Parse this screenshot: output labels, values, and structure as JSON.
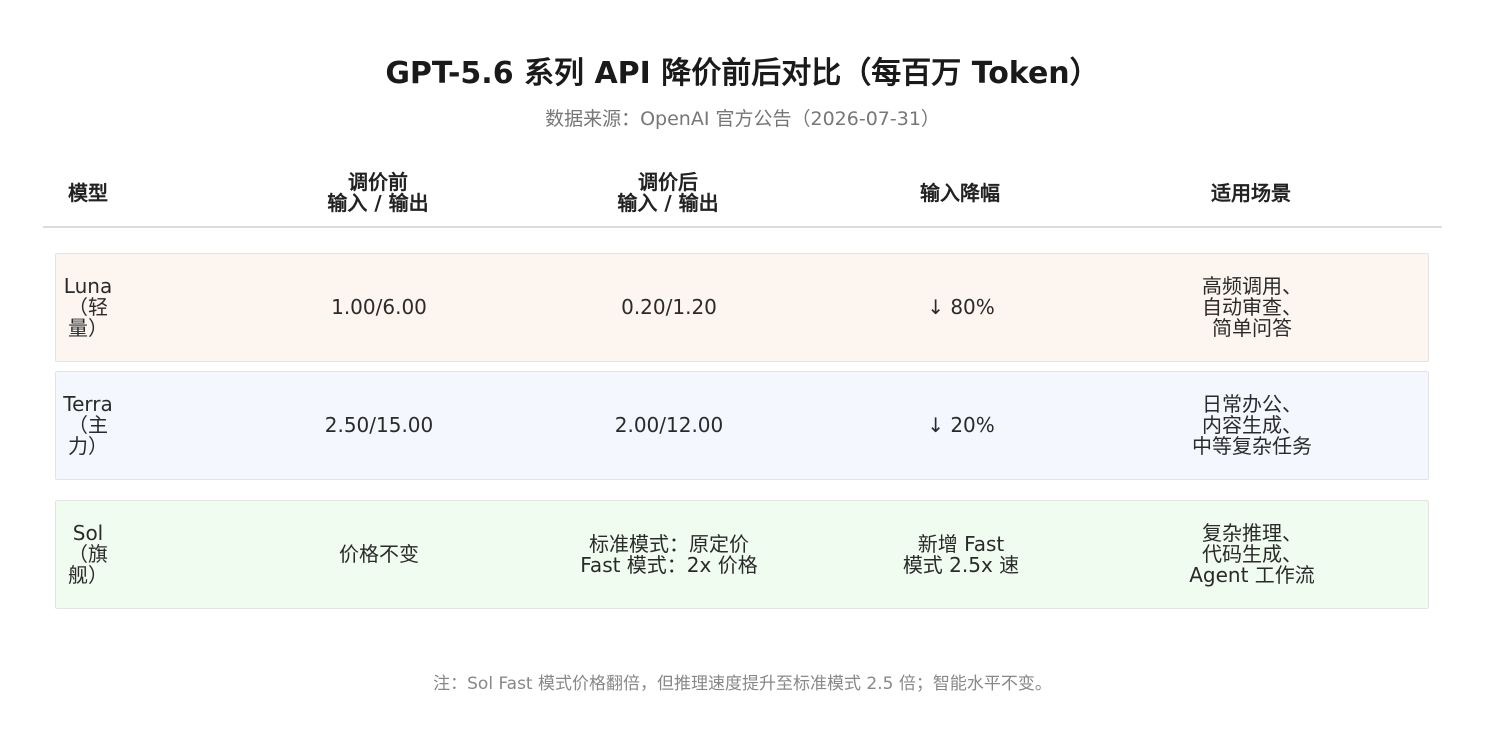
{
  "title": "GPT-5.6 系列 API 降价前后对比（每百万 Token）",
  "subtitle": "数据来源：OpenAI 官方公告（2026-07-31）",
  "table": {
    "headers": [
      "模型",
      "调价前\n输入 / 输出",
      "调价后\n输入 / 输出",
      "输入降幅",
      "适用场景"
    ],
    "rows": [
      {
        "model": "Luna\n（轻量）",
        "before": "1.00/6.00",
        "after": "0.20/1.20",
        "drop": "↓ 80%",
        "scenario": "高频调用、\n自动审查、\n简单问答"
      },
      {
        "model": "Terra\n（主力）",
        "before": "2.50/15.00",
        "after": "2.00/12.00",
        "drop": "↓ 20%",
        "scenario": "日常办公、\n内容生成、\n中等复杂任务"
      },
      {
        "model": "Sol\n（旗舰）",
        "before": "价格不变",
        "after": "标准模式：原定价\nFast 模式：2x 价格",
        "drop": "新增 Fast\n模式 2.5x 速",
        "scenario": "复杂推理、\n代码生成、\nAgent 工作流"
      }
    ],
    "row_colors": [
      "#fdf6f0",
      "#f4f7fd",
      "#f1fcf1"
    ]
  },
  "footnote": "注：Sol Fast 模式价格翻倍，但推理速度提升至标准模式 2.5 倍；智能水平不变。"
}
